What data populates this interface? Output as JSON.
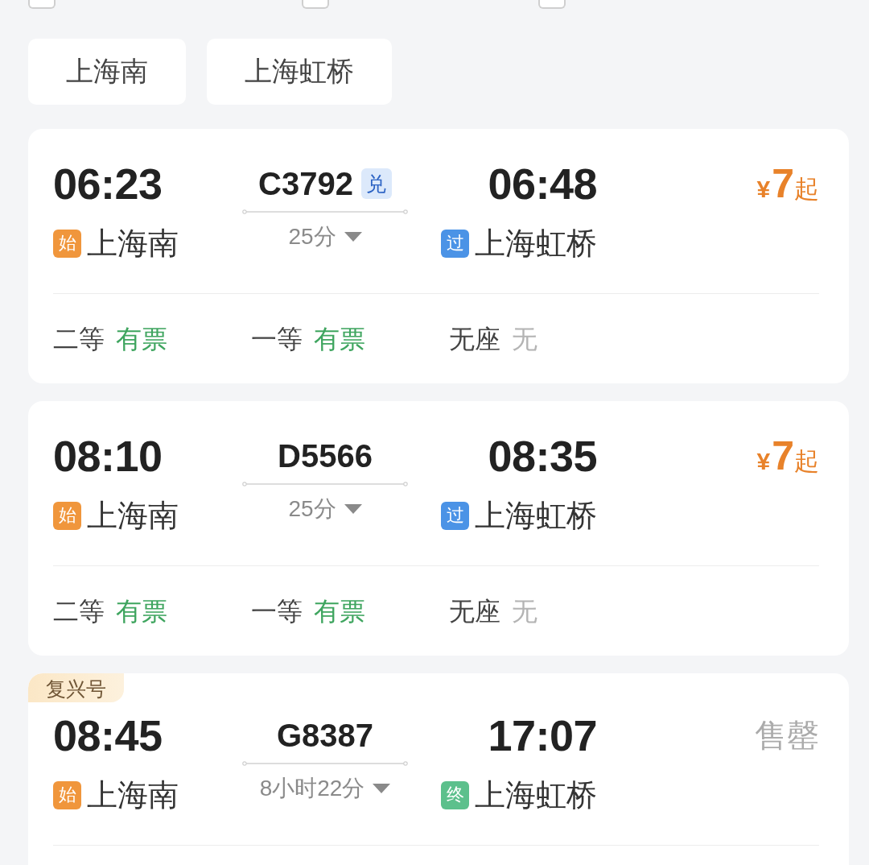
{
  "filters": [
    {
      "checked": false
    },
    {
      "checked": false
    },
    {
      "checked": false
    }
  ],
  "station_chips": [
    "上海南",
    "上海虹桥"
  ],
  "trains": [
    {
      "depart": {
        "time": "06:23",
        "tag": "始",
        "kind": "origin",
        "station": "上海南"
      },
      "number": "C3792",
      "badge": "兑",
      "duration": "25分",
      "arrive": {
        "time": "06:48",
        "tag": "过",
        "kind": "pass",
        "station": "上海虹桥"
      },
      "fare": {
        "kind": "price",
        "currency": "¥",
        "amount": "7",
        "suffix": "起"
      },
      "seats": [
        {
          "class": "二等",
          "availability": "有票",
          "kind": "available"
        },
        {
          "class": "一等",
          "availability": "有票",
          "kind": "available"
        },
        {
          "class": "无座",
          "availability": "无",
          "kind": "none"
        }
      ]
    },
    {
      "depart": {
        "time": "08:10",
        "tag": "始",
        "kind": "origin",
        "station": "上海南"
      },
      "number": "D5566",
      "duration": "25分",
      "arrive": {
        "time": "08:35",
        "tag": "过",
        "kind": "pass",
        "station": "上海虹桥"
      },
      "fare": {
        "kind": "price",
        "currency": "¥",
        "amount": "7",
        "suffix": "起"
      },
      "seats": [
        {
          "class": "二等",
          "availability": "有票",
          "kind": "available"
        },
        {
          "class": "一等",
          "availability": "有票",
          "kind": "available"
        },
        {
          "class": "无座",
          "availability": "无",
          "kind": "none"
        }
      ]
    },
    {
      "tag": "复兴号",
      "depart": {
        "time": "08:45",
        "tag": "始",
        "kind": "origin",
        "station": "上海南"
      },
      "number": "G8387",
      "duration": "8小时22分",
      "arrive": {
        "time": "17:07",
        "tag": "终",
        "kind": "terminal",
        "station": "上海虹桥"
      },
      "fare": {
        "kind": "sold_out",
        "text": "售罄"
      }
    }
  ]
}
